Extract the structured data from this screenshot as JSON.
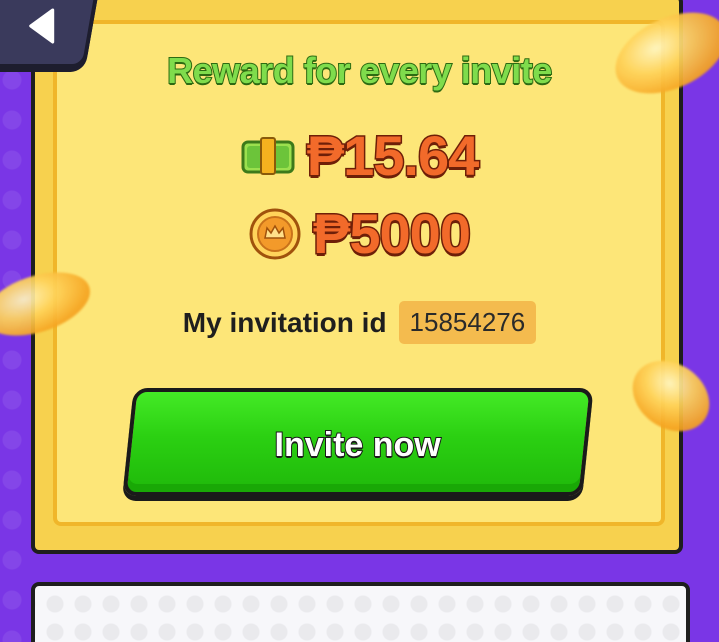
{
  "header": {
    "back_icon": "back-arrow-icon"
  },
  "reward": {
    "title": "Reward for every invite",
    "cash_icon": "cash-stack-icon",
    "cash_amount": "₱15.64",
    "coin_icon": "gold-coin-icon",
    "coin_amount": "₱5000"
  },
  "invitation": {
    "label": "My invitation id",
    "id": "15854276"
  },
  "actions": {
    "invite_label": "Invite now"
  },
  "colors": {
    "background": "#7a36e6",
    "card": "#f7d14e",
    "card_inner": "#fde678",
    "title_green": "#7fdc4c",
    "amount_orange": "#f26a2a",
    "button_green": "#2bd012"
  }
}
